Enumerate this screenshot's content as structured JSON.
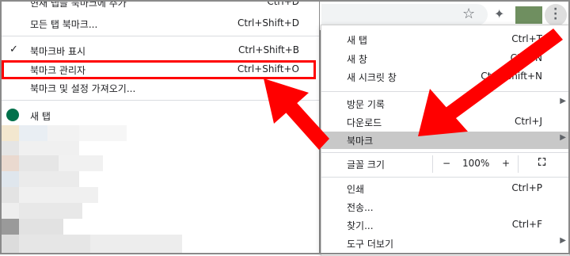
{
  "bookmarks_menu": {
    "items": [
      {
        "label": "현재 탭을 북마크에 추가",
        "shortcut": "Ctrl+D"
      },
      {
        "label": "모든 탭 북마크...",
        "shortcut": "Ctrl+Shift+D"
      },
      {
        "label": "북마크바 표시",
        "shortcut": "Ctrl+Shift+B"
      },
      {
        "label": "북마크 관리자",
        "shortcut": "Ctrl+Shift+O"
      },
      {
        "label": "북마크 및 설정 가져오기...",
        "shortcut": ""
      },
      {
        "label": "새 탭",
        "shortcut": ""
      }
    ]
  },
  "toolbar": {
    "star_icon": "star-icon",
    "extensions_icon": "puzzle-icon",
    "menu_icon": "kebab-icon"
  },
  "chrome_menu": {
    "new_tab": {
      "label": "새 탭",
      "shortcut": "Ctrl+T"
    },
    "new_window": {
      "label": "새 창",
      "shortcut": "Ctrl+N"
    },
    "incognito": {
      "label": "새 시크릿 창",
      "shortcut": "Ctrl+Shift+N"
    },
    "history": {
      "label": "방문 기록",
      "shortcut": ""
    },
    "downloads": {
      "label": "다운로드",
      "shortcut": "Ctrl+J"
    },
    "bookmarks": {
      "label": "북마크",
      "shortcut": ""
    },
    "zoom": {
      "label": "글꼴 크기",
      "minus": "−",
      "value": "100%",
      "plus": "+"
    },
    "print": {
      "label": "인쇄",
      "shortcut": "Ctrl+P"
    },
    "cast": {
      "label": "전송...",
      "shortcut": ""
    },
    "find": {
      "label": "찾기...",
      "shortcut": "Ctrl+F"
    },
    "more_tools": {
      "label": "도구 더보기",
      "shortcut": ""
    }
  },
  "colors": {
    "highlight": "#ff0000",
    "arrow": "#ff0000",
    "active_row": "#c8c8c8"
  }
}
